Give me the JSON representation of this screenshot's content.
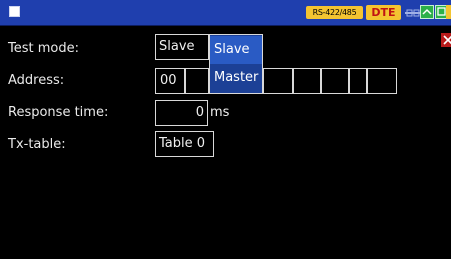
{
  "status": {
    "interface": "RS-422/485",
    "role": "DTE"
  },
  "labels": {
    "test_mode": "Test mode:",
    "address": "Address:",
    "response_time": "Response time:",
    "tx_table": "Tx-table:"
  },
  "fields": {
    "test_mode_value": "Slave",
    "address_cells": [
      "00",
      "",
      "",
      "",
      "",
      "",
      "",
      ""
    ],
    "response_time_value": "0",
    "response_time_unit": "ms",
    "tx_table_value": "Table 0"
  },
  "dropdown": {
    "options": [
      "Slave",
      "Master"
    ],
    "selected": "Slave"
  },
  "icons": [
    "window-icon",
    "link-icon",
    "signal-icon",
    "display-icon",
    "status-icon",
    "close-icon"
  ],
  "colors": {
    "titlebar": "#1f3fae",
    "badge": "#f3c431",
    "dropdown_bg": "#1c4096",
    "dropdown_selected": "#2a5bc4",
    "close": "#b81a1a"
  }
}
